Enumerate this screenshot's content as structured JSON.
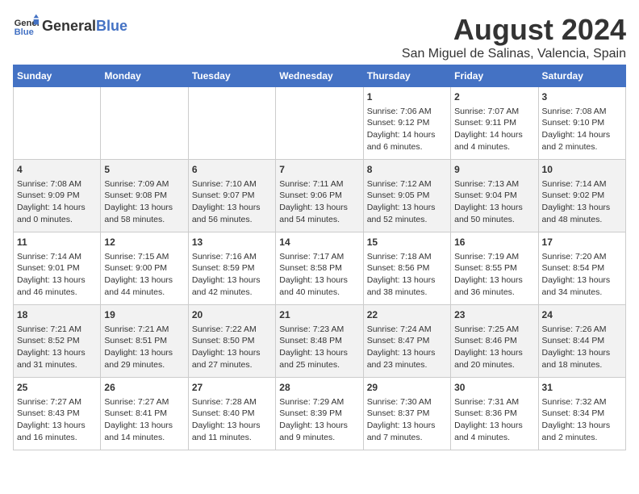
{
  "header": {
    "logo_general": "General",
    "logo_blue": "Blue",
    "title": "August 2024",
    "subtitle": "San Miguel de Salinas, Valencia, Spain"
  },
  "days_of_week": [
    "Sunday",
    "Monday",
    "Tuesday",
    "Wednesday",
    "Thursday",
    "Friday",
    "Saturday"
  ],
  "weeks": [
    [
      {
        "day": "",
        "content": ""
      },
      {
        "day": "",
        "content": ""
      },
      {
        "day": "",
        "content": ""
      },
      {
        "day": "",
        "content": ""
      },
      {
        "day": "1",
        "content": "Sunrise: 7:06 AM\nSunset: 9:12 PM\nDaylight: 14 hours\nand 6 minutes."
      },
      {
        "day": "2",
        "content": "Sunrise: 7:07 AM\nSunset: 9:11 PM\nDaylight: 14 hours\nand 4 minutes."
      },
      {
        "day": "3",
        "content": "Sunrise: 7:08 AM\nSunset: 9:10 PM\nDaylight: 14 hours\nand 2 minutes."
      }
    ],
    [
      {
        "day": "4",
        "content": "Sunrise: 7:08 AM\nSunset: 9:09 PM\nDaylight: 14 hours\nand 0 minutes."
      },
      {
        "day": "5",
        "content": "Sunrise: 7:09 AM\nSunset: 9:08 PM\nDaylight: 13 hours\nand 58 minutes."
      },
      {
        "day": "6",
        "content": "Sunrise: 7:10 AM\nSunset: 9:07 PM\nDaylight: 13 hours\nand 56 minutes."
      },
      {
        "day": "7",
        "content": "Sunrise: 7:11 AM\nSunset: 9:06 PM\nDaylight: 13 hours\nand 54 minutes."
      },
      {
        "day": "8",
        "content": "Sunrise: 7:12 AM\nSunset: 9:05 PM\nDaylight: 13 hours\nand 52 minutes."
      },
      {
        "day": "9",
        "content": "Sunrise: 7:13 AM\nSunset: 9:04 PM\nDaylight: 13 hours\nand 50 minutes."
      },
      {
        "day": "10",
        "content": "Sunrise: 7:14 AM\nSunset: 9:02 PM\nDaylight: 13 hours\nand 48 minutes."
      }
    ],
    [
      {
        "day": "11",
        "content": "Sunrise: 7:14 AM\nSunset: 9:01 PM\nDaylight: 13 hours\nand 46 minutes."
      },
      {
        "day": "12",
        "content": "Sunrise: 7:15 AM\nSunset: 9:00 PM\nDaylight: 13 hours\nand 44 minutes."
      },
      {
        "day": "13",
        "content": "Sunrise: 7:16 AM\nSunset: 8:59 PM\nDaylight: 13 hours\nand 42 minutes."
      },
      {
        "day": "14",
        "content": "Sunrise: 7:17 AM\nSunset: 8:58 PM\nDaylight: 13 hours\nand 40 minutes."
      },
      {
        "day": "15",
        "content": "Sunrise: 7:18 AM\nSunset: 8:56 PM\nDaylight: 13 hours\nand 38 minutes."
      },
      {
        "day": "16",
        "content": "Sunrise: 7:19 AM\nSunset: 8:55 PM\nDaylight: 13 hours\nand 36 minutes."
      },
      {
        "day": "17",
        "content": "Sunrise: 7:20 AM\nSunset: 8:54 PM\nDaylight: 13 hours\nand 34 minutes."
      }
    ],
    [
      {
        "day": "18",
        "content": "Sunrise: 7:21 AM\nSunset: 8:52 PM\nDaylight: 13 hours\nand 31 minutes."
      },
      {
        "day": "19",
        "content": "Sunrise: 7:21 AM\nSunset: 8:51 PM\nDaylight: 13 hours\nand 29 minutes."
      },
      {
        "day": "20",
        "content": "Sunrise: 7:22 AM\nSunset: 8:50 PM\nDaylight: 13 hours\nand 27 minutes."
      },
      {
        "day": "21",
        "content": "Sunrise: 7:23 AM\nSunset: 8:48 PM\nDaylight: 13 hours\nand 25 minutes."
      },
      {
        "day": "22",
        "content": "Sunrise: 7:24 AM\nSunset: 8:47 PM\nDaylight: 13 hours\nand 23 minutes."
      },
      {
        "day": "23",
        "content": "Sunrise: 7:25 AM\nSunset: 8:46 PM\nDaylight: 13 hours\nand 20 minutes."
      },
      {
        "day": "24",
        "content": "Sunrise: 7:26 AM\nSunset: 8:44 PM\nDaylight: 13 hours\nand 18 minutes."
      }
    ],
    [
      {
        "day": "25",
        "content": "Sunrise: 7:27 AM\nSunset: 8:43 PM\nDaylight: 13 hours\nand 16 minutes."
      },
      {
        "day": "26",
        "content": "Sunrise: 7:27 AM\nSunset: 8:41 PM\nDaylight: 13 hours\nand 14 minutes."
      },
      {
        "day": "27",
        "content": "Sunrise: 7:28 AM\nSunset: 8:40 PM\nDaylight: 13 hours\nand 11 minutes."
      },
      {
        "day": "28",
        "content": "Sunrise: 7:29 AM\nSunset: 8:39 PM\nDaylight: 13 hours\nand 9 minutes."
      },
      {
        "day": "29",
        "content": "Sunrise: 7:30 AM\nSunset: 8:37 PM\nDaylight: 13 hours\nand 7 minutes."
      },
      {
        "day": "30",
        "content": "Sunrise: 7:31 AM\nSunset: 8:36 PM\nDaylight: 13 hours\nand 4 minutes."
      },
      {
        "day": "31",
        "content": "Sunrise: 7:32 AM\nSunset: 8:34 PM\nDaylight: 13 hours\nand 2 minutes."
      }
    ]
  ]
}
